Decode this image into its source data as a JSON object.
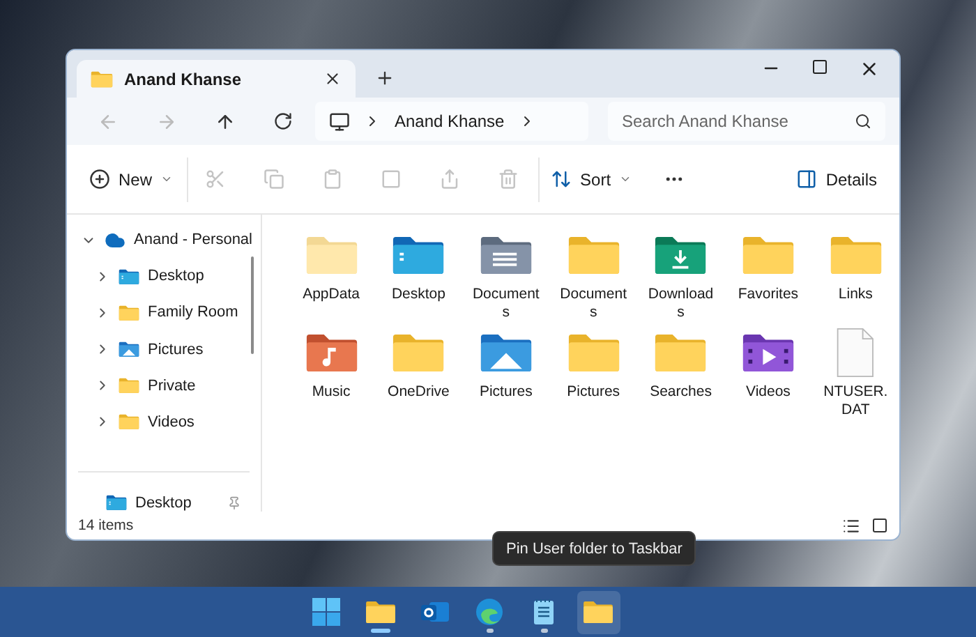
{
  "window": {
    "tabs": [
      {
        "title": "Anand Khanse",
        "selected": true
      }
    ]
  },
  "address": {
    "crumbs": [
      "Anand Khanse"
    ],
    "search_placeholder": "Search Anand Khanse"
  },
  "toolbar": [
    {
      "kind": "new",
      "label": "New",
      "disabled": false
    },
    {
      "kind": "cut",
      "disabled": true
    },
    {
      "kind": "copy",
      "disabled": true
    },
    {
      "kind": "paste",
      "disabled": true
    },
    {
      "kind": "rename",
      "disabled": true
    },
    {
      "kind": "share",
      "disabled": true
    },
    {
      "kind": "delete",
      "disabled": true
    },
    {
      "kind": "sort",
      "label": "Sort",
      "disabled": false
    },
    {
      "kind": "more",
      "disabled": false
    },
    {
      "kind": "details",
      "label": "Details",
      "disabled": false
    }
  ],
  "sidebar": {
    "items": [
      {
        "label": "Anand - Personal",
        "kind": "cloud",
        "expanded": true,
        "children": [
          {
            "label": "Desktop",
            "kind": "desktop",
            "expanded": false
          },
          {
            "label": "Family Room",
            "kind": "folder",
            "expanded": false
          },
          {
            "label": "Pictures",
            "kind": "pictures",
            "expanded": false
          },
          {
            "label": "Private",
            "kind": "folder",
            "expanded": false
          },
          {
            "label": "Videos",
            "kind": "folder",
            "expanded": false
          }
        ]
      }
    ],
    "pinned": [
      {
        "label": "Desktop",
        "kind": "desktop"
      }
    ]
  },
  "files": [
    {
      "name": "AppData",
      "kind": "folder",
      "hidden": true
    },
    {
      "name": "Desktop",
      "kind": "desktop",
      "hidden": false
    },
    {
      "name": "Documents",
      "kind": "documents",
      "hidden": false
    },
    {
      "name": "Documents",
      "kind": "folder",
      "hidden": false
    },
    {
      "name": "Downloads",
      "kind": "downloads",
      "hidden": false
    },
    {
      "name": "Favorites",
      "kind": "folder",
      "hidden": false
    },
    {
      "name": "Links",
      "kind": "folder",
      "hidden": false
    },
    {
      "name": "Music",
      "kind": "music",
      "hidden": false
    },
    {
      "name": "OneDrive",
      "kind": "folder",
      "hidden": false
    },
    {
      "name": "Pictures",
      "kind": "pictures",
      "hidden": false
    },
    {
      "name": "Pictures",
      "kind": "folder",
      "hidden": false
    },
    {
      "name": "Searches",
      "kind": "folder",
      "hidden": false
    },
    {
      "name": "Videos",
      "kind": "videos",
      "hidden": false
    },
    {
      "name": "NTUSER.DAT",
      "kind": "file",
      "hidden": false
    }
  ],
  "status_bar": {
    "count": "14 items"
  },
  "tooltip": "Pin User folder to Taskbar",
  "taskbar": [
    {
      "kind": "start",
      "running": false,
      "focused": false,
      "hovered": false
    },
    {
      "kind": "explorer",
      "running": true,
      "focused": true,
      "hovered": false
    },
    {
      "kind": "mail",
      "running": false,
      "focused": false,
      "hovered": false
    },
    {
      "kind": "browser",
      "running": true,
      "focused": false,
      "hovered": false
    },
    {
      "kind": "notepad",
      "running": true,
      "focused": false,
      "hovered": false
    },
    {
      "kind": "folder",
      "running": false,
      "focused": false,
      "hovered": true
    }
  ]
}
